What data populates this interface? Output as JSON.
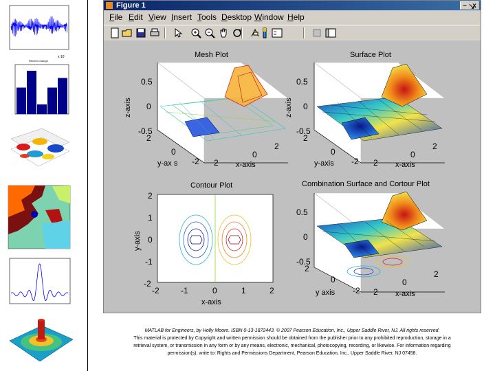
{
  "window": {
    "title": "Figure 1",
    "close_button": "x",
    "menu_arrow": "↘",
    "menu": [
      {
        "label": "File",
        "u": "F",
        "rest": "ile"
      },
      {
        "label": "Edit",
        "u": "E",
        "rest": "dit"
      },
      {
        "label": "View",
        "u": "V",
        "rest": "iew"
      },
      {
        "label": "Insert",
        "u": "I",
        "rest": "nsert"
      },
      {
        "label": "Tools",
        "u": "T",
        "rest": "ools"
      },
      {
        "label": "Desktop",
        "u": "D",
        "rest": "esktop"
      },
      {
        "label": "Window",
        "u": "W",
        "rest": "indow"
      },
      {
        "label": "Help",
        "u": "H",
        "rest": "elp"
      }
    ],
    "toolbar": [
      "new-file-icon",
      "open-folder-icon",
      "save-icon",
      "print-icon",
      "pointer-arrow-icon",
      "zoom-in-icon",
      "zoom-out-icon",
      "pan-hand-icon",
      "rotate-3d-icon",
      "data-cursor-icon",
      "colorbar-icon",
      "legend-icon",
      "hide-plot-tools-icon",
      "show-plot-tools-icon"
    ]
  },
  "plots": {
    "mesh": {
      "title": "Mesh Plot",
      "zlabel": "z-axis",
      "xlabel": "x-axis",
      "ylabel": "y-ax s",
      "zticks": [
        "0.5",
        "0",
        "-0.5"
      ],
      "yticks": [
        "2",
        "0",
        "-2"
      ],
      "xticks": [
        "2",
        "0",
        "2"
      ]
    },
    "surface": {
      "title": "Surface Plot",
      "zlabel": "z-axis",
      "xlabel": "x-axis",
      "ylabel": "y-axis",
      "zticks": [
        "0.5",
        "0",
        "-0.5"
      ],
      "yticks": [
        "2",
        "0",
        "-2"
      ],
      "xticks": [
        "2",
        "0",
        "2"
      ]
    },
    "contour": {
      "title": "Contour Plot",
      "xlabel": "x-axis",
      "ylabel": "y-axis",
      "yticks": [
        "2",
        "1",
        "0",
        "-1",
        "-2"
      ],
      "xticks": [
        "-2",
        "-1",
        "0",
        "1",
        "2"
      ]
    },
    "combo": {
      "title": "Combination Surface and Cortour Plot",
      "xlabel": "x-axis",
      "ylabel": "y axis",
      "zticks": [
        "0.5",
        "0",
        "-0.5"
      ],
      "yticks": [
        "2",
        "0",
        "-2"
      ],
      "xticks": [
        "2",
        "0",
        "2"
      ]
    }
  },
  "thumbs": {
    "audio_axis_x": "x 10´",
    "bar_title": "Recent Change",
    "bar_values": [
      0.55,
      0.9,
      0.2,
      0.55,
      0.75
    ]
  },
  "copyright": [
    "MATLAB for Engineers, by Holly Moore. ISBN 0-13-1872443. © 2007 Pearson Education, Inc., Upper Saddle River, NJ. All rights reserved.",
    "This material is protected by Copyright and written permission should be obtained from the publisher prior to any prohibited reproduction, storage in a",
    "retrieval system, or transmission in any form or by any means, electronic, mechanical, photocopying, recording, or likewise. For information regarding",
    "permission(s), write to: Rights and Permissions Department, Pearson Education, Inc., Upper Saddle River, NJ 07458."
  ]
}
